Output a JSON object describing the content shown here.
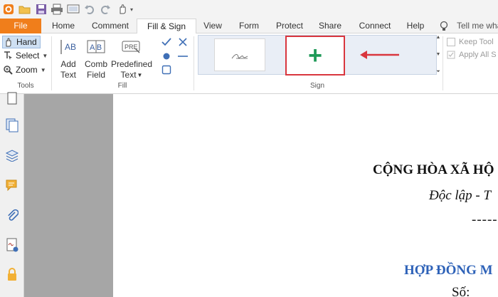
{
  "tabs": [
    {
      "label": "File"
    },
    {
      "label": "Home"
    },
    {
      "label": "Comment"
    },
    {
      "label": "Fill & Sign"
    },
    {
      "label": "View"
    },
    {
      "label": "Form"
    },
    {
      "label": "Protect"
    },
    {
      "label": "Share"
    },
    {
      "label": "Connect"
    },
    {
      "label": "Help"
    }
  ],
  "tell_me": "Tell me wha",
  "tools": {
    "hand": "Hand",
    "select": "Select",
    "zoom": "Zoom",
    "group_label": "Tools"
  },
  "fill": {
    "add_text": [
      "Add",
      "Text"
    ],
    "comb_field": [
      "Comb",
      "Field"
    ],
    "predefined_text": [
      "Predefined",
      "Text"
    ],
    "predefined_icon_text": "PRE",
    "add_icon_text": "AB",
    "comb_icon_text": "A B",
    "group_label": "Fill"
  },
  "sign": {
    "group_label": "Sign",
    "add_symbol": "+",
    "keep_tool": "Keep Tool",
    "apply_all": "Apply All S"
  },
  "document": {
    "line1": "CỘNG HÒA XÃ HỘ",
    "line2": "Độc lập - T",
    "line3": "-----",
    "line4": "HỢP ĐỒNG M",
    "line5": "Số:"
  },
  "colors": {
    "file_tab": "#f07e1b",
    "accent_green": "#1f9a58",
    "highlight_red": "#d9363e",
    "doc_blue": "#2e62b8"
  }
}
